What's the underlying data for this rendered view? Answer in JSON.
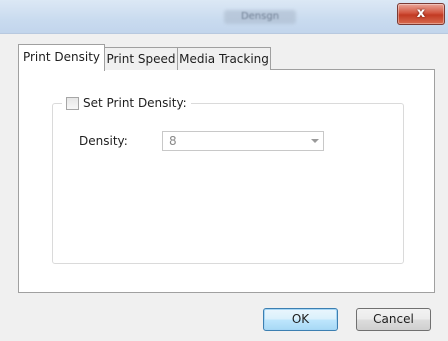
{
  "window": {
    "title_blurred": "Densgn",
    "close_label": "x"
  },
  "tabs": [
    {
      "label": "Print Density",
      "active": true
    },
    {
      "label": "Print Speed",
      "active": false
    },
    {
      "label": "Media Tracking",
      "active": false
    }
  ],
  "group": {
    "checkbox_label": "Set Print Density:",
    "checked": false
  },
  "density": {
    "label": "Density:",
    "value": "8",
    "enabled": false
  },
  "buttons": {
    "ok": "OK",
    "cancel": "Cancel"
  },
  "colors": {
    "titlebar": "#c9dbef",
    "close": "#c23a22",
    "default_button": "#bee6fd"
  }
}
